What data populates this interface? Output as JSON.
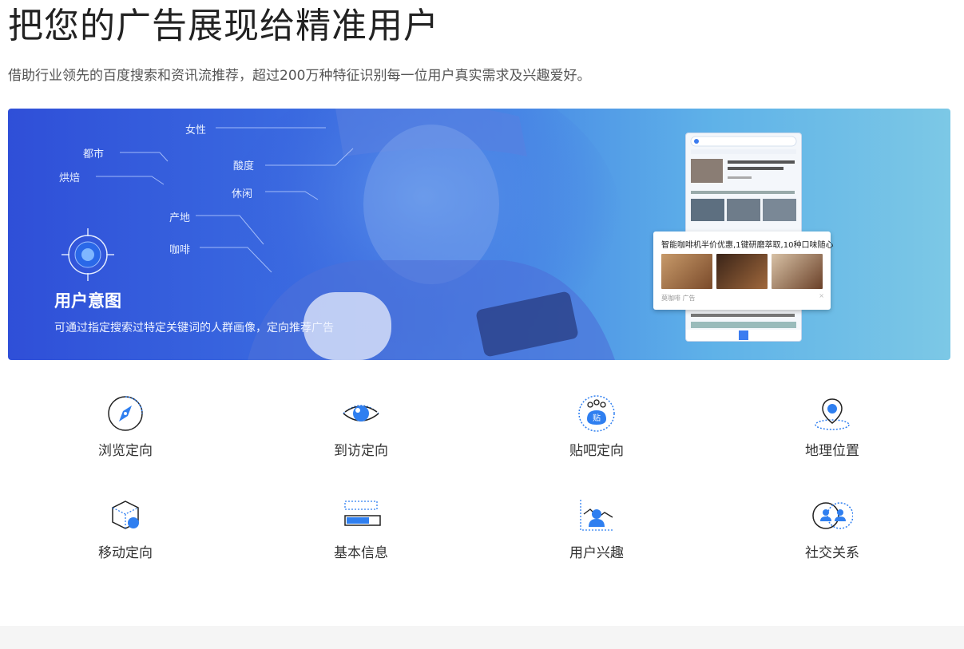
{
  "page": {
    "title": "把您的广告展现给精准用户",
    "subtitle": "借助行业领先的百度搜索和资讯流推荐，超过200万种特征识别每一位用户真实需求及兴趣爱好。"
  },
  "banner": {
    "keywords": [
      "女性",
      "都市",
      "烘焙",
      "酸度",
      "休闲",
      "产地",
      "咖啡"
    ],
    "intent_title": "用户意图",
    "intent_desc": "可通过指定搜索过特定关键词的人群画像，定向推荐广告",
    "ad_card": {
      "title": "智能咖啡机半价优惠,1键研磨萃取,10种口味随心",
      "meta": "莫咖啡 广告",
      "close": "×"
    },
    "colors": {
      "gradient_start": "#2f4fd8",
      "gradient_end": "#7cc8e6",
      "accent": "#2f7ff0"
    }
  },
  "features": [
    {
      "label": "浏览定向",
      "icon": "compass-icon"
    },
    {
      "label": "到访定向",
      "icon": "eye-icon"
    },
    {
      "label": "贴吧定向",
      "icon": "tieba-paw-icon"
    },
    {
      "label": "地理位置",
      "icon": "location-pin-icon"
    },
    {
      "label": "移动定向",
      "icon": "cube-icon"
    },
    {
      "label": "基本信息",
      "icon": "progress-bar-icon"
    },
    {
      "label": "用户兴趣",
      "icon": "user-chart-icon"
    },
    {
      "label": "社交关系",
      "icon": "social-users-icon"
    }
  ]
}
